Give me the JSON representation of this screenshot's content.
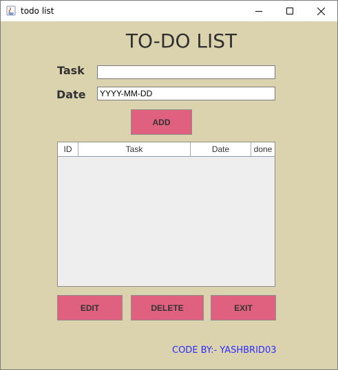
{
  "window": {
    "title": "todo list",
    "controls": [
      "minimize-icon",
      "maximize-icon",
      "close-icon"
    ]
  },
  "heading": "TO-DO LIST",
  "form": {
    "task_label": "Task",
    "task_value": "",
    "date_label": "Date",
    "date_value": "YYYY-MM-DD"
  },
  "buttons": {
    "add": "ADD",
    "edit": "EDIT",
    "delete": "DELETE",
    "exit": "EXIT"
  },
  "table": {
    "columns": [
      "ID",
      "Task",
      "Date",
      "done"
    ],
    "rows": []
  },
  "footer": "CODE BY:- YASHBRID03",
  "colors": {
    "background": "#dbd3ae",
    "button": "#e0607f",
    "footer_text": "#2b2bff"
  }
}
